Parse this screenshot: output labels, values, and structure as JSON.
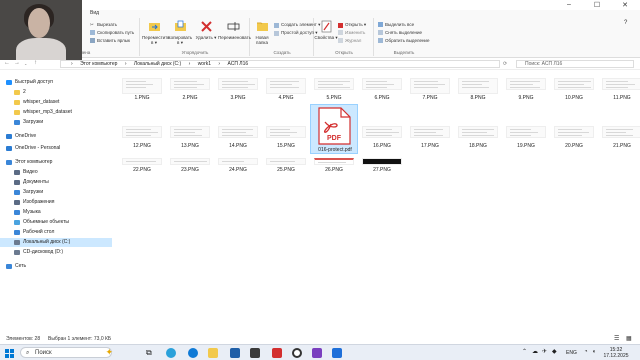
{
  "window": {
    "ribbon_tab": "Вид"
  },
  "ribbon": {
    "clipboard": {
      "cut": "Вырезать",
      "copy_path": "Скопировать путь",
      "paste_shortcut": "Вставить ярлык",
      "label": "Буфер обмена"
    },
    "organize": {
      "move": "Переместить в ▾",
      "copy": "Копировать в ▾",
      "delete": "Удалить ▾",
      "rename": "Переименовать",
      "label": "Упорядочить"
    },
    "create": {
      "new_folder": "Новая папка",
      "new_item": "Создать элемент ▾",
      "easy_access": "Простой доступ ▾",
      "label": "Создать"
    },
    "open": {
      "properties": "Свойства ▾",
      "open": "Открыть ▾",
      "edit": "Изменить",
      "history": "Журнал",
      "label": "Открыть"
    },
    "select": {
      "select_all": "Выделить все",
      "select_none": "Снять выделение",
      "invert": "Обратить выделение",
      "label": "Выделить"
    }
  },
  "address": {
    "crumbs": [
      "›",
      "Этот компьютер",
      "›",
      "Локальный диск (C:)",
      "›",
      "work1",
      "›",
      "АСП Л16"
    ],
    "search_placeholder": "Поиск: АСП Л16"
  },
  "sidebar": {
    "items": [
      {
        "label": "Быстрый доступ",
        "icon": "star-icon",
        "color": "#1e90ff"
      },
      {
        "label": "2",
        "icon": "folder-icon",
        "color": "#f2c94c"
      },
      {
        "label": "whisper_dataset",
        "icon": "folder-icon",
        "color": "#f2c94c"
      },
      {
        "label": "whisper_mp3_dataset",
        "icon": "folder-icon",
        "color": "#f2c94c"
      },
      {
        "label": "Загрузки",
        "icon": "download-icon",
        "color": "#3a86d8"
      },
      {
        "label": "OneDrive",
        "icon": "cloud-icon",
        "color": "#2b7cd3"
      },
      {
        "label": "OneDrive - Personal",
        "icon": "cloud-icon",
        "color": "#2b7cd3"
      },
      {
        "label": "Этот компьютер",
        "icon": "computer-icon",
        "color": "#3a86d8"
      },
      {
        "label": "Видео",
        "icon": "video-icon",
        "color": "#5b6b84"
      },
      {
        "label": "Документы",
        "icon": "documents-icon",
        "color": "#5b6b84"
      },
      {
        "label": "Загрузки",
        "icon": "download-icon",
        "color": "#3a86d8"
      },
      {
        "label": "Изображения",
        "icon": "pictures-icon",
        "color": "#5b6b84"
      },
      {
        "label": "Музыка",
        "icon": "music-icon",
        "color": "#3a86d8"
      },
      {
        "label": "Объемные объекты",
        "icon": "3d-objects-icon",
        "color": "#4aa3df"
      },
      {
        "label": "Рабочий стол",
        "icon": "desktop-icon",
        "color": "#3a86d8"
      },
      {
        "label": "Локальный диск (C:)",
        "icon": "drive-icon",
        "color": "#6b7a90"
      },
      {
        "label": "CD-дисковод (D:)",
        "icon": "cd-drive-icon",
        "color": "#6b7a90"
      },
      {
        "label": "Сеть",
        "icon": "network-icon",
        "color": "#3a86d8"
      }
    ]
  },
  "files": [
    "1.PNG",
    "2.PNG",
    "3.PNG",
    "4.PNG",
    "5.PNG",
    "6.PNG",
    "7.PNG",
    "8.PNG",
    "9.PNG",
    "10.PNG",
    "11.PNG",
    "12.PNG",
    "13.PNG",
    "14.PNG",
    "15.PNG",
    "016-protect.pdf",
    "16.PNG",
    "17.PNG",
    "18.PNG",
    "19.PNG",
    "20.PNG",
    "21.PNG",
    "22.PNG",
    "23.PNG",
    "24.PNG",
    "25.PNG",
    "26.PNG",
    "27.PNG"
  ],
  "pdf_badge": "PDF",
  "selected_file": "016-protect.pdf",
  "status": {
    "count": "Элементов: 28",
    "selection": "Выбран 1 элемент: 73,0 КБ"
  },
  "taskbar": {
    "search": "Поиск",
    "lang": "ENG",
    "time": "15:32",
    "date": "17.12.2025"
  },
  "colors": {
    "accent": "#0078d4",
    "selection": "#cce8ff",
    "pdf_red": "#d32f2f"
  }
}
